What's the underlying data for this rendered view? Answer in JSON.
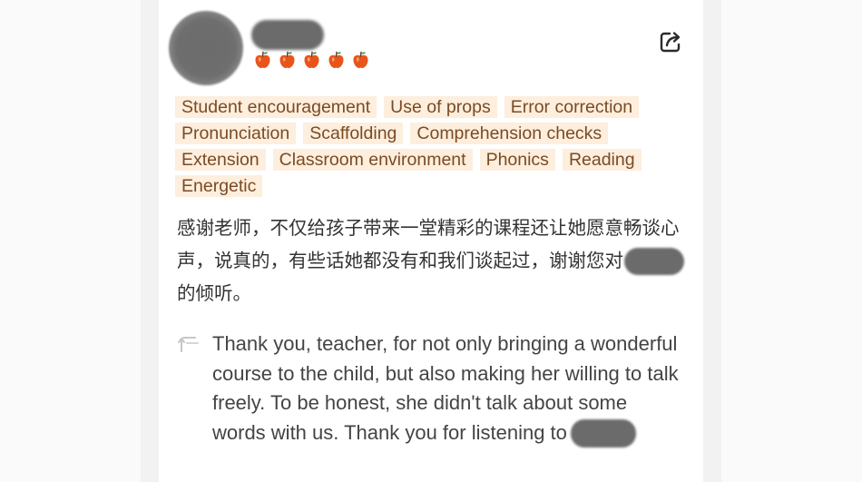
{
  "reviewer": {
    "avatar_icon": "avatar-blurred",
    "name_redacted": true,
    "rating": 5,
    "rating_icon": "apple-icon",
    "rating_color": "#e8541b"
  },
  "actions": {
    "share_icon": "share-icon"
  },
  "tags": [
    "Student encouragement",
    "Use of props",
    "Error correction",
    "Pronunciation",
    "Scaffolding",
    "Comprehension checks",
    "Extension",
    "Classroom environment",
    "Phonics",
    "Reading",
    "Energetic"
  ],
  "tag_colors": {
    "background": "#fdeedd",
    "text": "#7a4b24"
  },
  "review": {
    "text_before_redaction": "感谢老师，不仅给孩子带来一堂精彩的课程还让她愿意畅谈心声，说真的，有些话她都没有和我们谈起过，谢谢您对",
    "text_after_redaction": "的倾听。"
  },
  "translation": {
    "icon": "translate-reply-icon",
    "text_before_redaction": "Thank you, teacher, for not only bringing a wonderful course to the child, but also making her willing to talk freely. To be honest, she didn't talk about some words with us. Thank you for listening to"
  }
}
